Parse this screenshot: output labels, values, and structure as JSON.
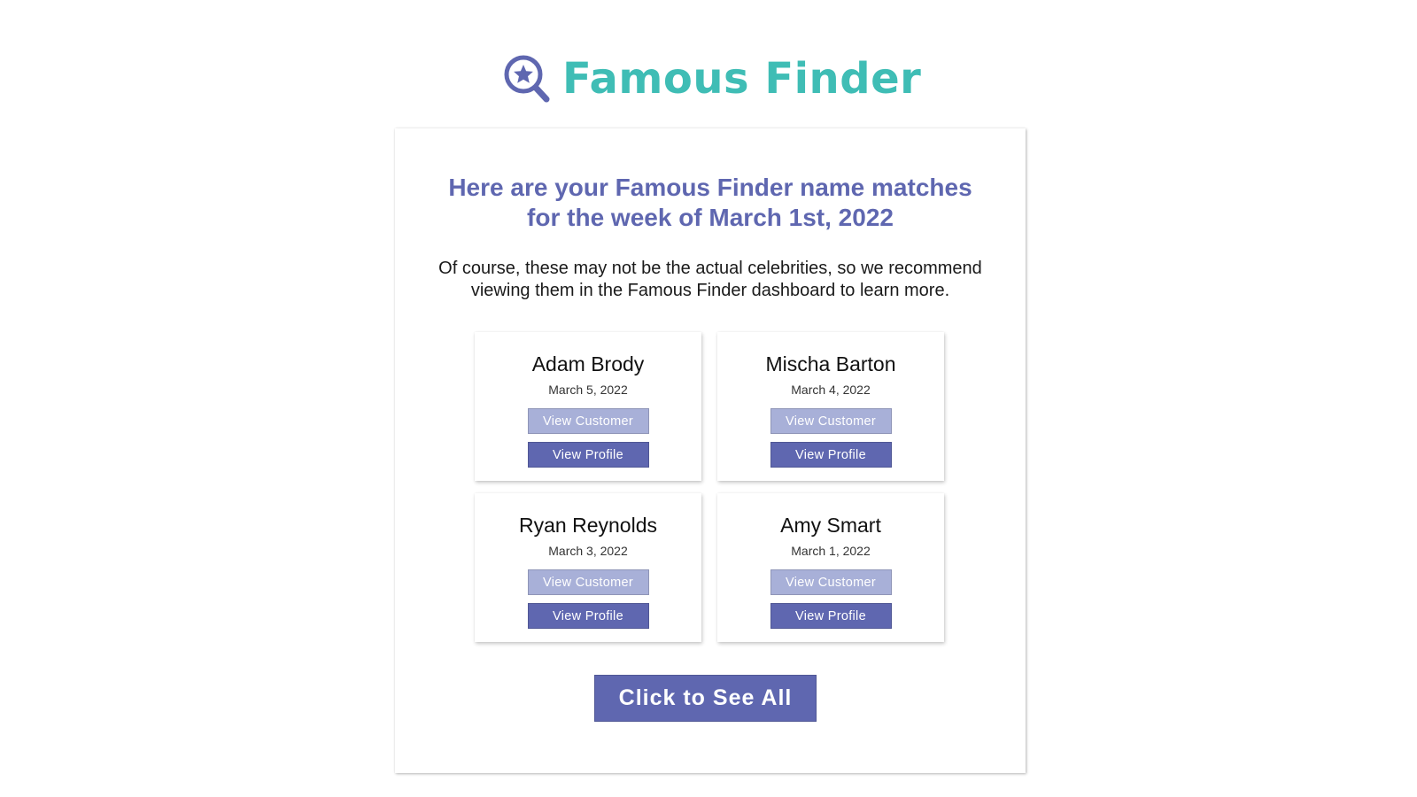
{
  "brand": {
    "name": "Famous Finder",
    "logo_icon": "magnifier-star-icon",
    "text_color": "#3fbdb5",
    "icon_color": "#5f67b0"
  },
  "colors": {
    "heading": "#5f67b0",
    "customer_button": "#a8b0d8",
    "profile_button": "#5f67b0",
    "cta_button": "#5f67b0"
  },
  "email": {
    "headline_lines": [
      "Here are your Famous Finder name matches",
      "for the week of March 1st, 2022"
    ],
    "intro_lines": [
      "Of course, these may not be the actual celebrities, so we recommend",
      "viewing them in the Famous Finder dashboard to learn more."
    ],
    "matches": [
      {
        "name": "Adam Brody",
        "date": "March 5, 2022",
        "customer_label": "View Customer",
        "profile_label": "View Profile"
      },
      {
        "name": "Mischa Barton",
        "date": "March 4, 2022",
        "customer_label": "View Customer",
        "profile_label": "View Profile"
      },
      {
        "name": "Ryan Reynolds",
        "date": "March 3, 2022",
        "customer_label": "View Customer",
        "profile_label": "View Profile"
      },
      {
        "name": "Amy Smart",
        "date": "March 1, 2022",
        "customer_label": "View Customer",
        "profile_label": "View Profile"
      }
    ],
    "cta_label": "Click to See All"
  }
}
